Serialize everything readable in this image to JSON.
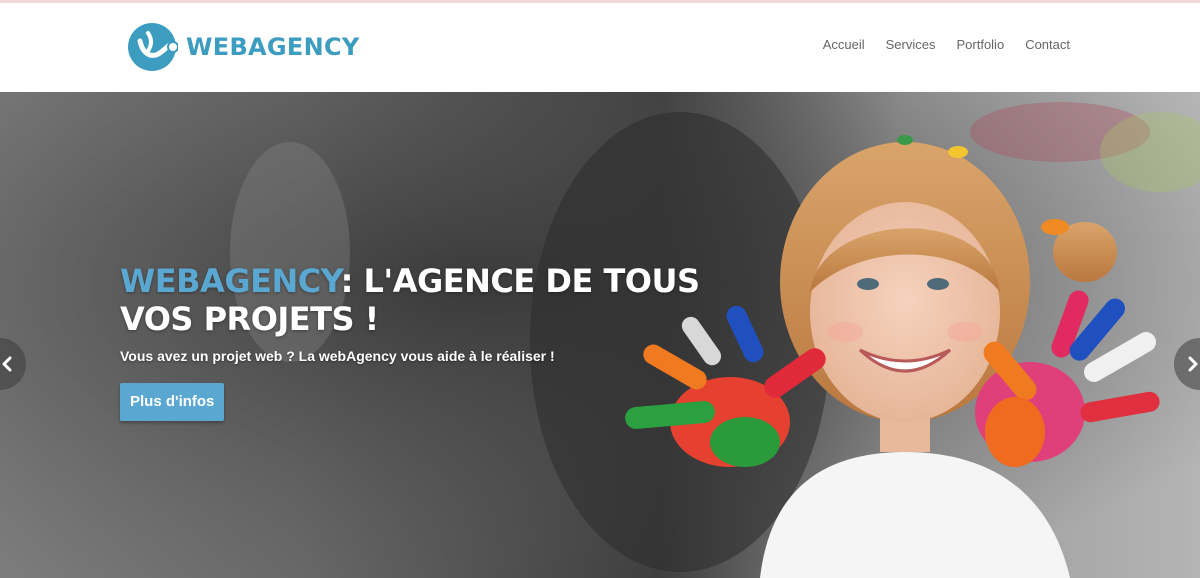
{
  "colors": {
    "brand": "#3d9dc0",
    "brand_dark": "#2a7fa3",
    "nav_text": "#666666",
    "hero_text": "#ffffff",
    "cta_bg": "#5aa8d2",
    "cta_text": "#ffffff"
  },
  "logo": {
    "text": "WEBAGENCY",
    "icon": "webagency-logo-icon"
  },
  "nav": {
    "items": [
      {
        "label": "Accueil"
      },
      {
        "label": "Services"
      },
      {
        "label": "Portfolio"
      },
      {
        "label": "Contact"
      }
    ]
  },
  "hero": {
    "headline_brand": "WEBAGENCY",
    "headline_rest": ": L'AGENCE DE TOUS VOS PROJETS !",
    "subline": "Vous avez un projet web ? La webAgency vous aide à le réaliser !",
    "cta_label": "Plus d'infos",
    "image": "girl-with-painted-hands-photo"
  },
  "carousel": {
    "prev_icon": "chevron-left-icon",
    "next_icon": "chevron-right-icon"
  }
}
